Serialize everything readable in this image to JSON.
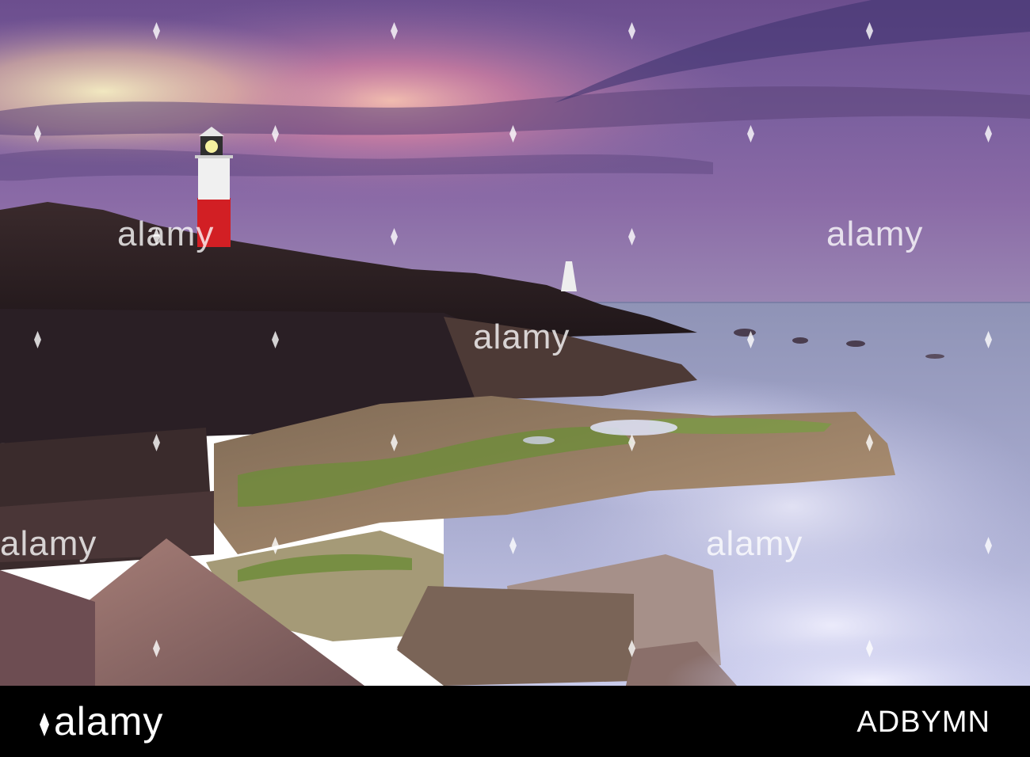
{
  "photo": {
    "subject": "Lighthouse on rocky coast at sunset with misty sea",
    "palette": {
      "sky_top": "#4a3b7a",
      "sky_mid": "#8a6aa6",
      "sky_glow": "#f1a6b0",
      "horizon_yellow": "#f3e4b5",
      "sea": "#8b92b6",
      "mist": "#dfe2f5",
      "rock_dark": "#2a1f25",
      "rock_light": "#b79a7f",
      "moss": "#6e8c3a",
      "lighthouse_red": "#d21f24",
      "lighthouse_white": "#f0f0f0"
    }
  },
  "watermark": {
    "word": "alamy",
    "icon": "diamond-icon"
  },
  "footer": {
    "logo_text": "alamy",
    "image_code": "ADBYMN"
  }
}
